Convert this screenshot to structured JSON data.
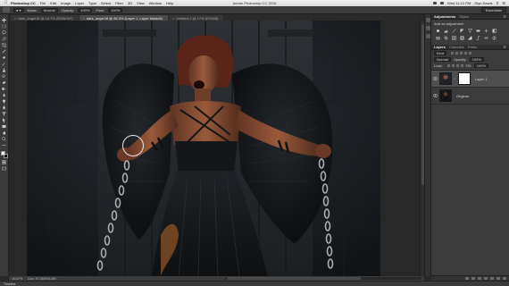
{
  "menubar": {
    "app_name": "Photoshop CC",
    "items": [
      "File",
      "Edit",
      "Image",
      "Layer",
      "Type",
      "Select",
      "Filter",
      "3D",
      "View",
      "Window",
      "Help"
    ],
    "window_title": "Adobe Photoshop CC 2015",
    "status_time": "Wed 11:12 PM",
    "user": "Glyn Dewis"
  },
  "options_bar": {
    "mode_label": "Mode:",
    "mode_value": "Normal",
    "opacity_label": "Opacity:",
    "opacity_value": "100%",
    "flow_label": "Flow:",
    "flow_value": "100%",
    "right_button": "Essentials"
  },
  "tabs": [
    {
      "label": "dark_angel.tif @ 16.7% (RGB/16*)",
      "active": false
    },
    {
      "label": "dark_angel.tif @ 66.3% (Layer 1, Layer Mask/8)",
      "active": true
    },
    {
      "label": "Untitled-1 @ 17% (RGB/8)",
      "active": false
    }
  ],
  "status_bar": {
    "zoom": "16.67%",
    "doc_info": "Doc: 97.4M/194.8M"
  },
  "timeline_label": "Timeline",
  "adjustments_panel": {
    "tabs": [
      "Adjustments",
      "Styles"
    ],
    "subtitle": "Add an adjustment",
    "icons": [
      "brightness-icon",
      "levels-icon",
      "curves-icon",
      "exposure-icon",
      "vibrance-icon",
      "hue-icon",
      "color-balance-icon",
      "bw-icon",
      "photo-filter-icon",
      "channel-mixer-icon",
      "color-lookup-icon",
      "invert-icon",
      "posterize-icon",
      "threshold-icon",
      "gradient-map-icon",
      "selective-color-icon"
    ]
  },
  "layers_panel": {
    "tabs": [
      "Layers",
      "Channels",
      "Paths"
    ],
    "kind_label": "Kind",
    "blend_mode": "Normal",
    "opacity_label": "Opacity:",
    "opacity_value": "100%",
    "lock_label": "Lock:",
    "fill_label": "Fill:",
    "fill_value": "100%",
    "layers": [
      {
        "name": "Layer 1",
        "selected": true,
        "has_mask": true
      },
      {
        "name": "Original",
        "selected": false,
        "has_mask": false
      }
    ]
  },
  "colors": {
    "ui_dark": "#282828",
    "panel": "#3b3b3b",
    "canvas_bg": "#1a1d20",
    "skin": "#8a4f34",
    "hair": "#5b2418"
  }
}
